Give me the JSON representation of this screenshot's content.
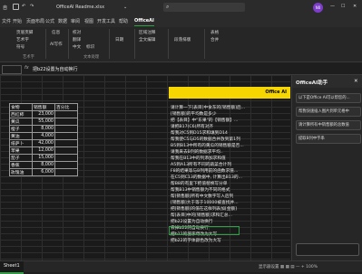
{
  "titlebar": {
    "autosave": "自",
    "doc_title": "OfficeAI Readme.xlsx",
    "avatar_initials": "N0"
  },
  "menu": [
    "文件",
    "开始",
    "页面布局",
    "公式",
    "数据",
    "审阅",
    "视图",
    "开发工具",
    "帮助",
    "OfficeAI"
  ],
  "ribbon": {
    "row1": [
      "页眉页脚",
      "艺术字",
      "符号"
    ],
    "col2": [
      "信息",
      "AI写作"
    ],
    "col3": [
      "校对",
      "翻译",
      "中文",
      "标识"
    ],
    "col4": [
      "日期"
    ],
    "col5": [
      "区域注释",
      "全文编辑"
    ],
    "col6": [
      "段落排版"
    ],
    "col7": [
      "表格",
      "合并"
    ],
    "groups": [
      "艺术字",
      "文本处理"
    ]
  },
  "formula_bar": {
    "fx": "fx",
    "content": "把b22设置为自动换行"
  },
  "table": {
    "headers": [
      "食物",
      "销售额",
      "百分比"
    ],
    "rows": [
      [
        "西红柿",
        "23,000"
      ],
      [
        "黄瓜",
        "55,000"
      ],
      [
        "橙子",
        "8,000"
      ],
      [
        "黄油",
        "4,000"
      ],
      [
        "纸萨卜",
        "42,000"
      ],
      [
        "苹果",
        "12,000"
      ],
      [
        "茄子",
        "15,000"
      ],
      [
        "香蕉",
        "8,000"
      ],
      [
        "玫瑰油",
        "6,000"
      ]
    ]
  },
  "yellow_bar": "Office AI",
  "notes": [
    "请计算一下[表目]中食东的[销售额]后...",
    "[销售额]的平均数是多少",
    "把【表目】中\"东果\"的【销售额】...",
    "请把B17(C6)所有对齐",
    "帮我对C5到D15求和填到D14",
    "帮我使C5与D5的数据合并放到第1列",
    "B5到B13中所有的黄瓜的销售额是否...",
    "请我来去B列的数据求平均..",
    "帮我在B13中的列添加求和值",
    "A5到A13所有不同的蔬菜合计列",
    "F8的结果等与B列用前的函数求值...",
    "在C5到C13的数据中, 计算出B13的...",
    "帮B8的有里下把值替换写分单",
    "帮我B13中销售额为不同的格式",
    "帮[销售额]所有中文数字写入后列",
    "[销售额]大于等于10000被查找并...",
    "把[销售额]的值在这样列表加[金额]",
    "帮[表目]中的[销售额]求和汇总...",
    "",
    "把b22设置为自动换行",
    "去掉b22的自动换行",
    "把b22的值字母改为大写",
    "把b22的字体颜色改为大写"
  ],
  "panel": {
    "title": "OfficeAI助手",
    "buttons": [
      "以下是Office AI可以帮您的...",
      "帮我快速插入图片到单元格中",
      "请计算所有中销售额的总数值",
      "提取B列中字串"
    ]
  },
  "sheet": {
    "tab": "Sheet1",
    "status": "显示器设置  ▦  ▦  ▤  — + 100%"
  }
}
